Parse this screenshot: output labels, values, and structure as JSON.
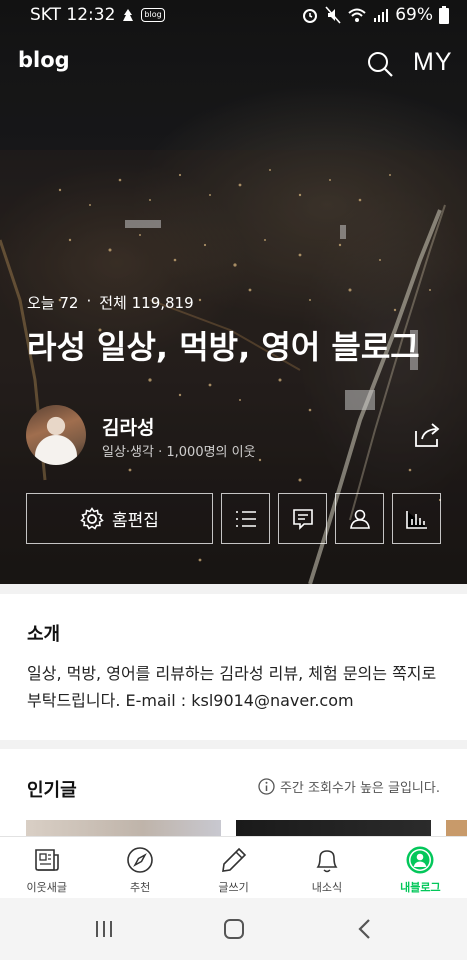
{
  "status_bar": {
    "carrier_time": "SKT 12:32",
    "badge": "blog",
    "battery": "69%",
    "icons": [
      "signal-icon",
      "alarm-icon",
      "mute-icon",
      "wifi-icon",
      "battery-icon"
    ]
  },
  "header": {
    "logo": "blog",
    "my_label": "MY"
  },
  "stats": {
    "today": "오늘 72",
    "separator": "·",
    "total": "전체 119,819"
  },
  "blog_title": "라성 일상, 먹방, 영어 블로그",
  "profile": {
    "name": "김라성",
    "subtitle": "일상·생각 · 1,000명의 이웃"
  },
  "actions": {
    "home_edit": "홈편집"
  },
  "intro": {
    "heading": "소개",
    "text": "일상, 먹방, 영어를 리뷰하는 김라성  리뷰, 체험 문의는 쪽지로 부탁드립니다. E-mail : ksl9014@naver.com"
  },
  "popular": {
    "heading": "인기글",
    "note": "주간 조회수가 높은 글입니다."
  },
  "bottom_nav": {
    "items": [
      {
        "label": "이웃새글",
        "icon": "news-icon"
      },
      {
        "label": "추천",
        "icon": "compass-icon"
      },
      {
        "label": "글쓰기",
        "icon": "pencil-icon"
      },
      {
        "label": "내소식",
        "icon": "bell-icon"
      },
      {
        "label": "내블로그",
        "icon": "profile-icon"
      }
    ],
    "active_index": 4,
    "active_color": "#03c75a"
  }
}
